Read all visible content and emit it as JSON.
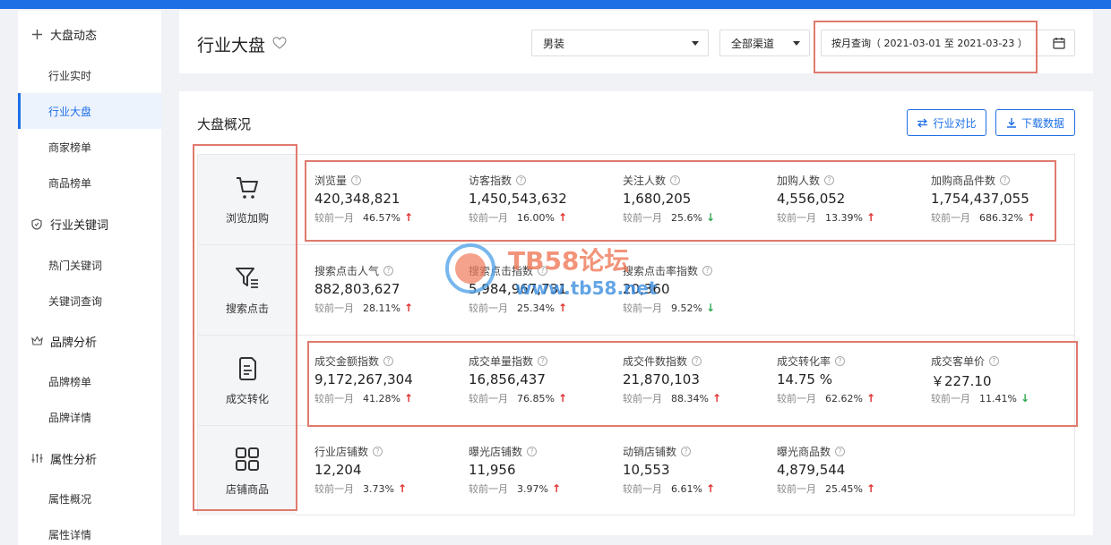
{
  "sidebar": {
    "groups": [
      {
        "label": "大盘动态",
        "icon": "plus-cross-icon",
        "items": [
          "行业实时",
          "行业大盘",
          "商家榜单",
          "商品榜单"
        ]
      },
      {
        "label": "行业关键词",
        "icon": "shield-icon",
        "items": [
          "热门关键词",
          "关键词查询"
        ]
      },
      {
        "label": "品牌分析",
        "icon": "crown-icon",
        "items": [
          "品牌榜单",
          "品牌详情"
        ]
      },
      {
        "label": "属性分析",
        "icon": "sliders-icon",
        "items": [
          "属性概况",
          "属性详情"
        ]
      }
    ],
    "active_item": "行业大盘"
  },
  "header": {
    "title": "行业大盘",
    "category_select": "男装",
    "channel_select": "全部渠道",
    "date_range": "按月查询（ 2021-03-01 至 2021-03-23 ）"
  },
  "main": {
    "title": "大盘概况",
    "compare_button": "行业对比",
    "download_button": "下载数据",
    "compare_prefix": "较前一月",
    "rows": [
      {
        "category": "浏览加购",
        "icon": "cart-icon",
        "metrics": [
          {
            "label": "浏览量",
            "value": "420,348,821",
            "pct": "46.57%",
            "dir": "up"
          },
          {
            "label": "访客指数",
            "value": "1,450,543,632",
            "pct": "16.00%",
            "dir": "up"
          },
          {
            "label": "关注人数",
            "value": "1,680,205",
            "pct": "25.6%",
            "dir": "down"
          },
          {
            "label": "加购人数",
            "value": "4,556,052",
            "pct": "13.39%",
            "dir": "up"
          },
          {
            "label": "加购商品件数",
            "value": "1,754,437,055",
            "pct": "686.32%",
            "dir": "up"
          }
        ]
      },
      {
        "category": "搜索点击",
        "icon": "filter-icon",
        "metrics": [
          {
            "label": "搜索点击人气",
            "value": "882,803,627",
            "pct": "28.11%",
            "dir": "up"
          },
          {
            "label": "搜索点击指数",
            "value": "5,984,967,731",
            "pct": "25.34%",
            "dir": "up"
          },
          {
            "label": "搜索点击率指数",
            "value": "20,360",
            "pct": "9.52%",
            "dir": "down"
          }
        ]
      },
      {
        "category": "成交转化",
        "icon": "document-icon",
        "metrics": [
          {
            "label": "成交金额指数",
            "value": "9,172,267,304",
            "pct": "41.28%",
            "dir": "up"
          },
          {
            "label": "成交单量指数",
            "value": "16,856,437",
            "pct": "76.85%",
            "dir": "up"
          },
          {
            "label": "成交件数指数",
            "value": "21,870,103",
            "pct": "88.34%",
            "dir": "up"
          },
          {
            "label": "成交转化率",
            "value": "14.75 %",
            "pct": "62.62%",
            "dir": "up"
          },
          {
            "label": "成交客单价",
            "value": "￥227.10",
            "pct": "11.41%",
            "dir": "down"
          }
        ]
      },
      {
        "category": "店铺商品",
        "icon": "grid-icon",
        "metrics": [
          {
            "label": "行业店铺数",
            "value": "12,204",
            "pct": "3.73%",
            "dir": "up"
          },
          {
            "label": "曝光店铺数",
            "value": "11,956",
            "pct": "3.97%",
            "dir": "up"
          },
          {
            "label": "动销店铺数",
            "value": "10,553",
            "pct": "6.61%",
            "dir": "up"
          },
          {
            "label": "曝光商品数",
            "value": "4,879,544",
            "pct": "25.45%",
            "dir": "up"
          }
        ]
      }
    ]
  },
  "watermark": {
    "title": "TB58论坛",
    "url": "www.tb58.net"
  },
  "colors": {
    "accent": "#1e6fe6",
    "up": "#e0302f",
    "down": "#2fa84f",
    "highlight": "#e07a6e"
  }
}
